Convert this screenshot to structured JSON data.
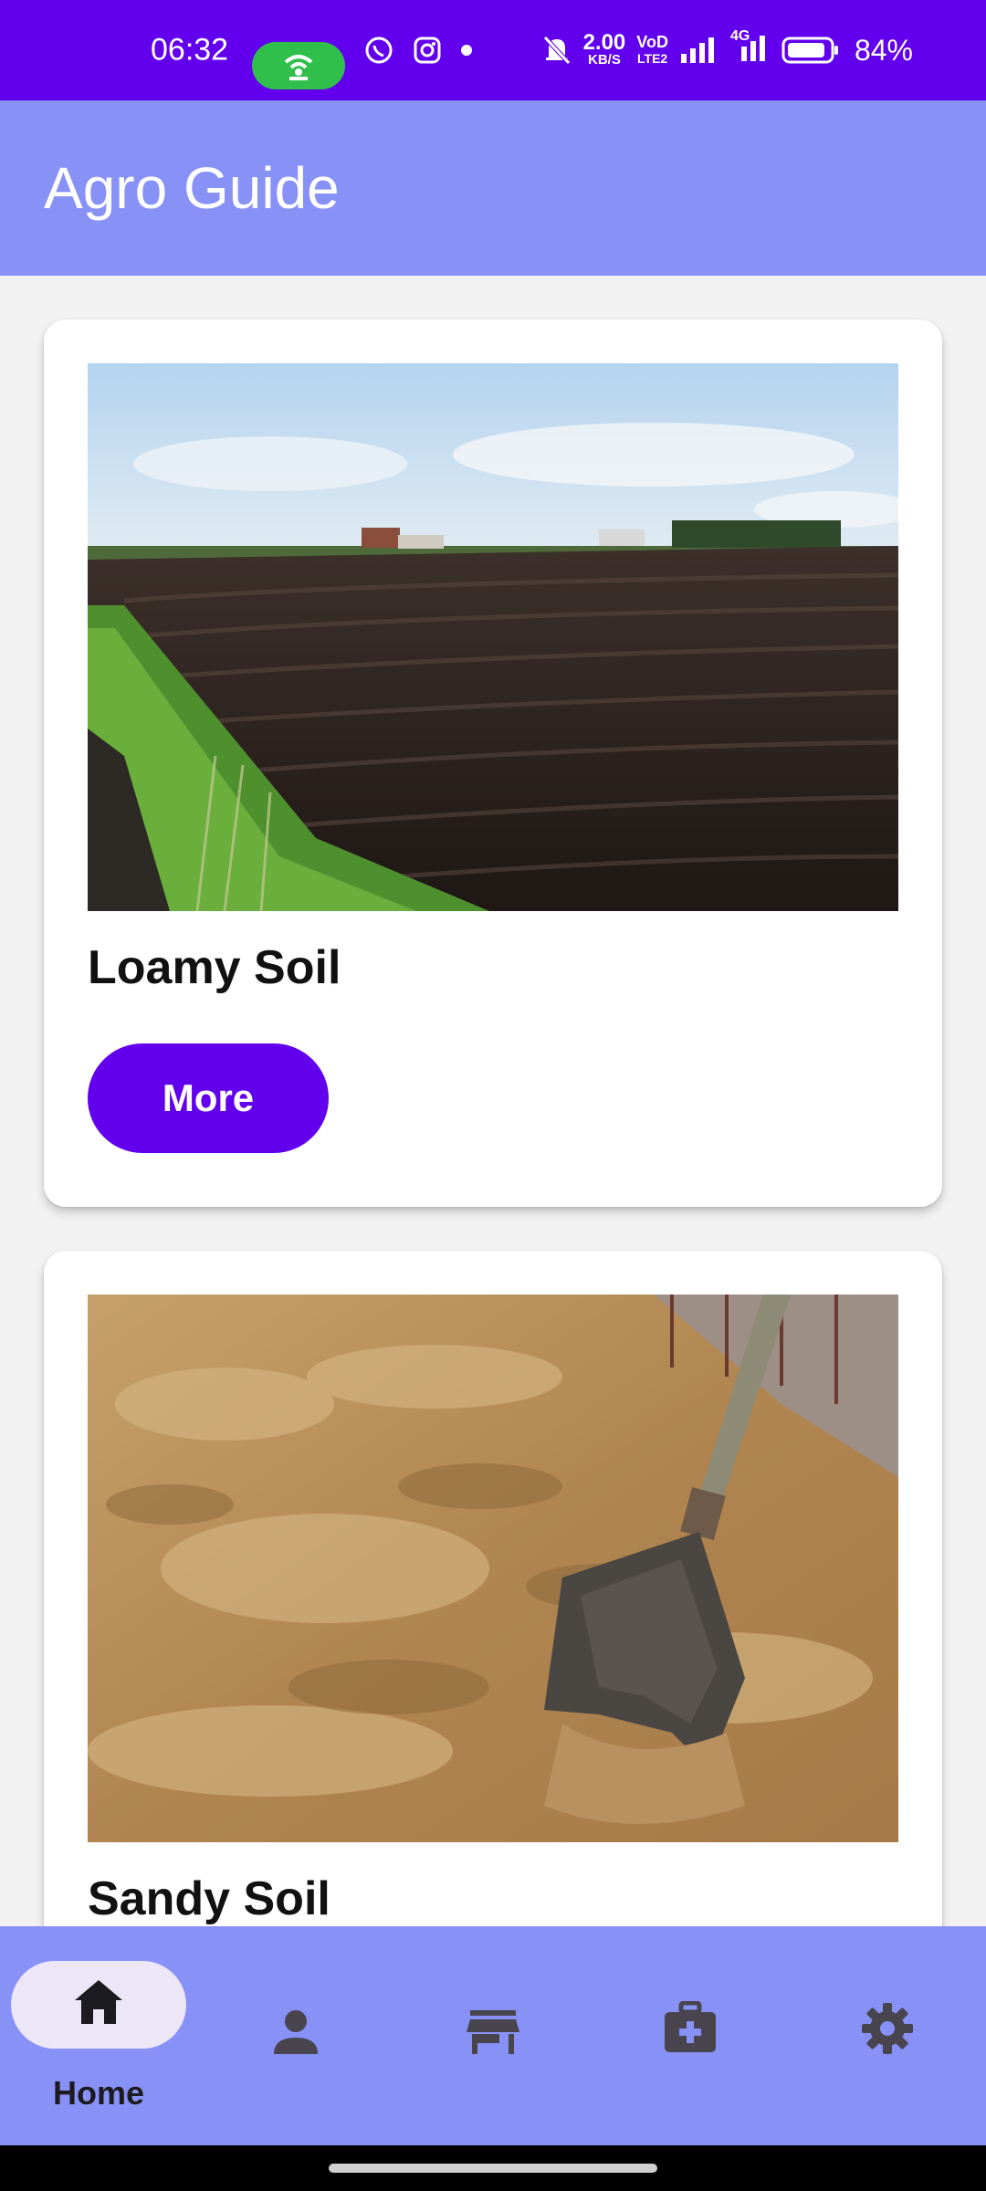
{
  "status_bar": {
    "time": "06:32",
    "network_speed": "2.00",
    "network_speed_unit": "KB/S",
    "vo_label": "VoD",
    "lte_label": "LTE2",
    "net_type": "4G",
    "battery": "84%",
    "icons": [
      "hotspot-icon",
      "whatsapp-icon",
      "instagram-icon",
      "dot-icon",
      "mute-icon",
      "signal-icon",
      "battery-icon"
    ]
  },
  "app_bar": {
    "title": "Agro Guide"
  },
  "cards": [
    {
      "title": "Loamy Soil",
      "button_label": "More",
      "image": "plowed-field-image"
    },
    {
      "title": "Sandy Soil",
      "image": "sand-shovel-image"
    }
  ],
  "bottom_nav": {
    "items": [
      {
        "label": "Home",
        "icon": "home-icon",
        "active": true
      },
      {
        "icon": "person-icon"
      },
      {
        "icon": "store-icon"
      },
      {
        "icon": "medical-kit-icon"
      },
      {
        "icon": "gear-icon"
      }
    ],
    "colors": {
      "bar": "#8891f5",
      "active_pill": "#ece6f7",
      "icon": "#49454f"
    }
  },
  "colors": {
    "primary": "#6200ee",
    "app_bar": "#8891f5",
    "background": "#f2f2f2"
  }
}
